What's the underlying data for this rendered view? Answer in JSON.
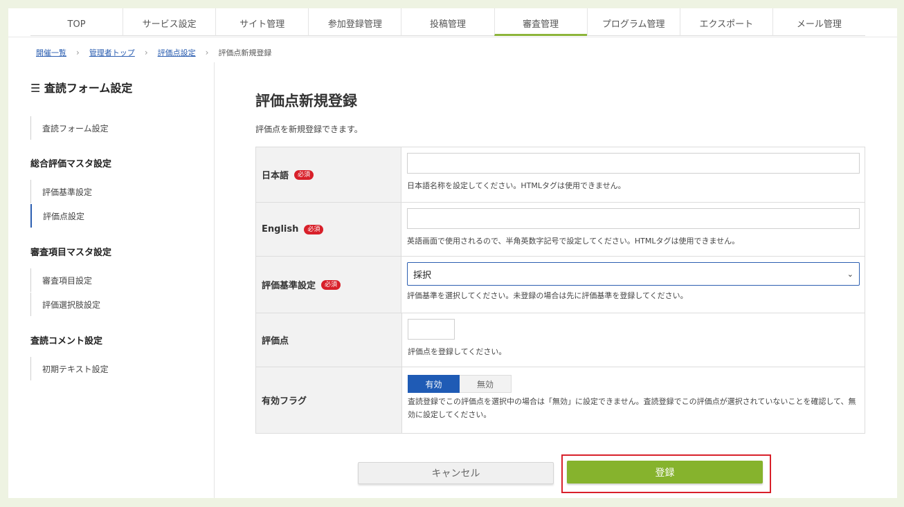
{
  "topnav": {
    "tabs": [
      {
        "label": "TOP"
      },
      {
        "label": "サービス設定"
      },
      {
        "label": "サイト管理"
      },
      {
        "label": "参加登録管理"
      },
      {
        "label": "投稿管理"
      },
      {
        "label": "審査管理",
        "active": true
      },
      {
        "label": "プログラム管理"
      },
      {
        "label": "エクスポート"
      },
      {
        "label": "メール管理"
      }
    ]
  },
  "breadcrumb": {
    "items": [
      "開催一覧",
      "管理者トップ",
      "評価点設定"
    ],
    "current": "評価点新規登録"
  },
  "sidebar": {
    "title": "☰ 査読フォーム設定",
    "item_form": "査読フォーム設定",
    "group1_title": "総合評価マスタ設定",
    "item_criteria": "評価基準設定",
    "item_score": "評価点設定",
    "group2_title": "審査項目マスタ設定",
    "item_review": "審査項目設定",
    "item_choice": "評価選択肢設定",
    "group3_title": "査読コメント設定",
    "item_initial": "初期テキスト設定"
  },
  "main": {
    "title": "評価点新規登録",
    "description": "評価点を新規登録できます。",
    "required_label": "必須",
    "fields": {
      "japanese": {
        "label": "日本語",
        "value": "",
        "hint": "日本語名称を設定してください。HTMLタグは使用できません。"
      },
      "english": {
        "label": "English",
        "value": "",
        "hint": "英語画面で使用されるので、半角英数字記号で設定してください。HTMLタグは使用できません。"
      },
      "criteria": {
        "label": "評価基準設定",
        "selected": "採択",
        "hint": "評価基準を選択してください。未登録の場合は先に評価基準を登録してください。"
      },
      "score": {
        "label": "評価点",
        "value": "",
        "hint": "評価点を登録してください。"
      },
      "enabled": {
        "label": "有効フラグ",
        "on_label": "有効",
        "off_label": "無効",
        "hint": "査読登録でこの評価点を選択中の場合は「無効」に設定できません。査読登録でこの評価点が選択されていないことを確認して、無効に設定してください。"
      }
    },
    "cancel_label": "キャンセル",
    "submit_label": "登録"
  },
  "colors": {
    "accent_green": "#86b32d",
    "link_blue": "#2a5db0",
    "required_red": "#d8202a",
    "toggle_blue": "#1f5bb5"
  }
}
